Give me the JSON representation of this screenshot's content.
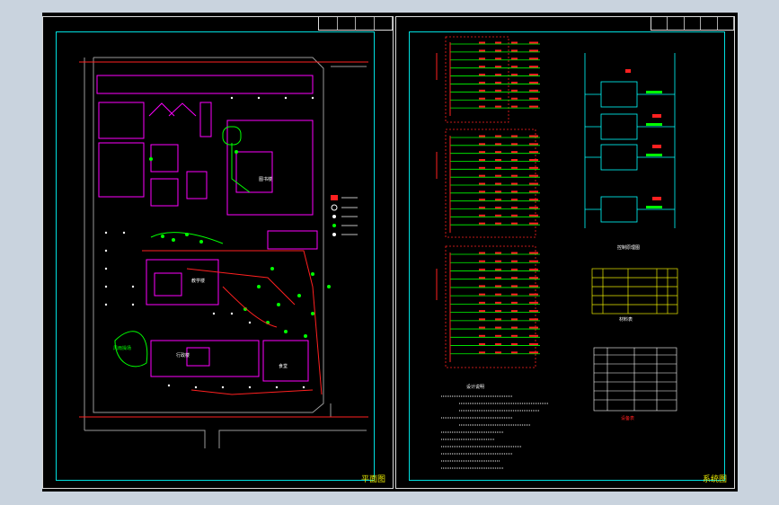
{
  "sheets": {
    "left_title": "平面图",
    "right_title": "系统图"
  },
  "labels": {
    "block_a": "行政楼",
    "block_b": "教学楼",
    "block_c": "风雨操场",
    "block_d": "食堂",
    "block_e": "图书楼",
    "table_caption_1": "材料表",
    "table_caption_2": "设备表",
    "diagram_caption": "控制原理图",
    "notes_title": "设计说明"
  },
  "colors": {
    "background": "#000000",
    "frame": "#00e0e0",
    "magenta": "#ff00ff",
    "green": "#00ff00",
    "red": "#ff2020",
    "white": "#ffffff",
    "yellow": "#e8e800",
    "cyan": "#00ffff"
  }
}
